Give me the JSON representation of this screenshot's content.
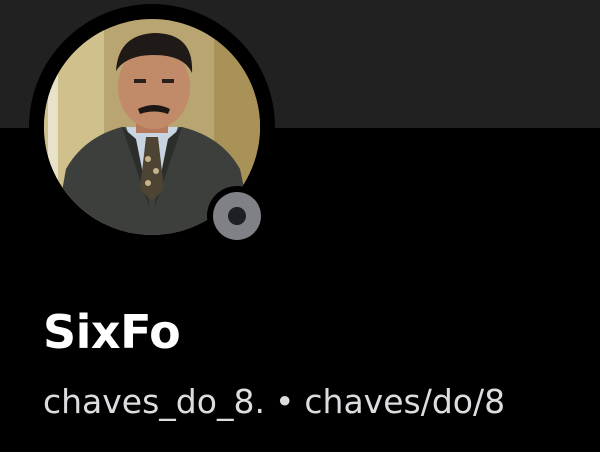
{
  "profile": {
    "display_name": "SixFo",
    "username": "chaves_do_8.",
    "separator": "•",
    "pronouns": "chaves/do/8",
    "avatar_icon": "man-in-suit-portrait",
    "status": "offline"
  },
  "colors": {
    "background": "#000000",
    "banner": "#212121",
    "status_dot": "#7f8187",
    "status_inner": "#1e1f22",
    "name_text": "#ffffff",
    "subtext": "#dcdde1"
  }
}
